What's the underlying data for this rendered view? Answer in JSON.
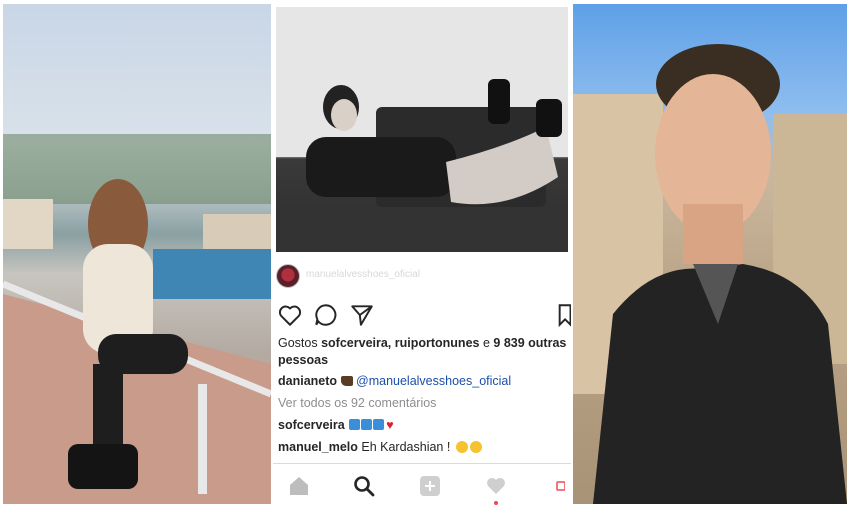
{
  "post": {
    "username": "manuelalvesshoes_oficial",
    "likes_prefix": "Gostos",
    "likes_users": "sofcerveira, ruiportonunes",
    "likes_conj": "e",
    "likes_count": "9 839 outras",
    "likes_suffix": "pessoas",
    "caption_user": "danianeto",
    "caption_mention": "@manuelalvesshoes_oficial",
    "view_comments": "Ver todos os 92 comentários",
    "comments": [
      {
        "user": "sofcerveira",
        "text": ""
      },
      {
        "user": "manuel_melo",
        "text": "Eh Kardashian !"
      }
    ]
  },
  "colors": {
    "link": "#1d4fa8",
    "heart": "#ed4956",
    "muted": "#8e8e8e"
  },
  "icons": [
    "heart-icon",
    "comment-icon",
    "share-icon",
    "bookmark-icon",
    "home-icon",
    "search-icon",
    "add-icon",
    "activity-icon",
    "profile-icon"
  ]
}
